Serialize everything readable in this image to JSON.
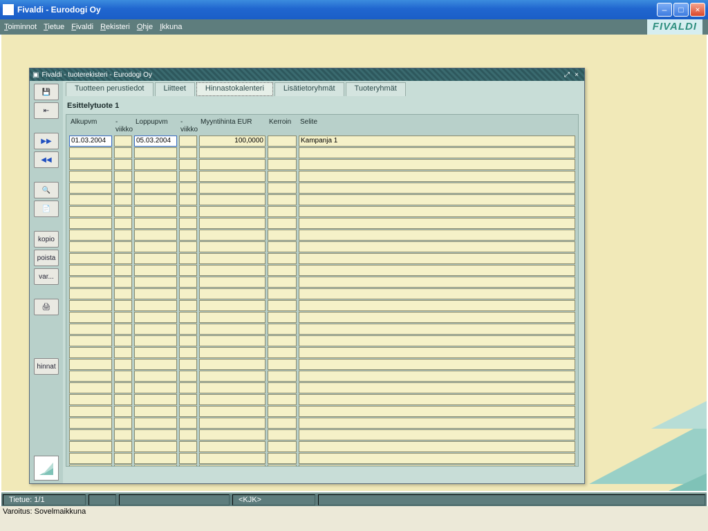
{
  "window": {
    "title": "Fivaldi - Eurodogi Oy"
  },
  "menu": {
    "items": [
      "Toiminnot",
      "Tietue",
      "Fivaldi",
      "Rekisteri",
      "Ohje",
      "Ikkuna"
    ],
    "brand": "FIVALDI"
  },
  "inner": {
    "title": "Fivaldi - tuoterekisteri - Eurodogi Oy",
    "tabs": [
      "Tuotteen perustiedot",
      "Liitteet",
      "Hinnastokalenteri",
      "Lisätietoryhmät",
      "Tuoteryhmät"
    ],
    "active_tab_index": 2,
    "subheader": "Esittelytuote 1",
    "toolbar_labels": {
      "kopio": "kopio",
      "poista": "poista",
      "var": "var...",
      "hinnat": "hinnat"
    },
    "grid": {
      "headers": [
        "Alkupvm",
        "-viikko",
        "Loppupvm",
        "-viikko",
        "Myyntihinta   EUR",
        "Kerroin",
        "Selite"
      ],
      "row": {
        "alkupvm": "01.03.2004",
        "vk1": "",
        "loppupvm": "05.03.2004",
        "vk2": "",
        "hinta": "100,0000",
        "kerroin": "",
        "selite": "Kampanja 1"
      },
      "empty_rows": 29
    }
  },
  "status": {
    "tietue": "Tietue: 1/1",
    "user": "<KJK>",
    "warning": "Varoitus: Sovelmaikkuna"
  }
}
